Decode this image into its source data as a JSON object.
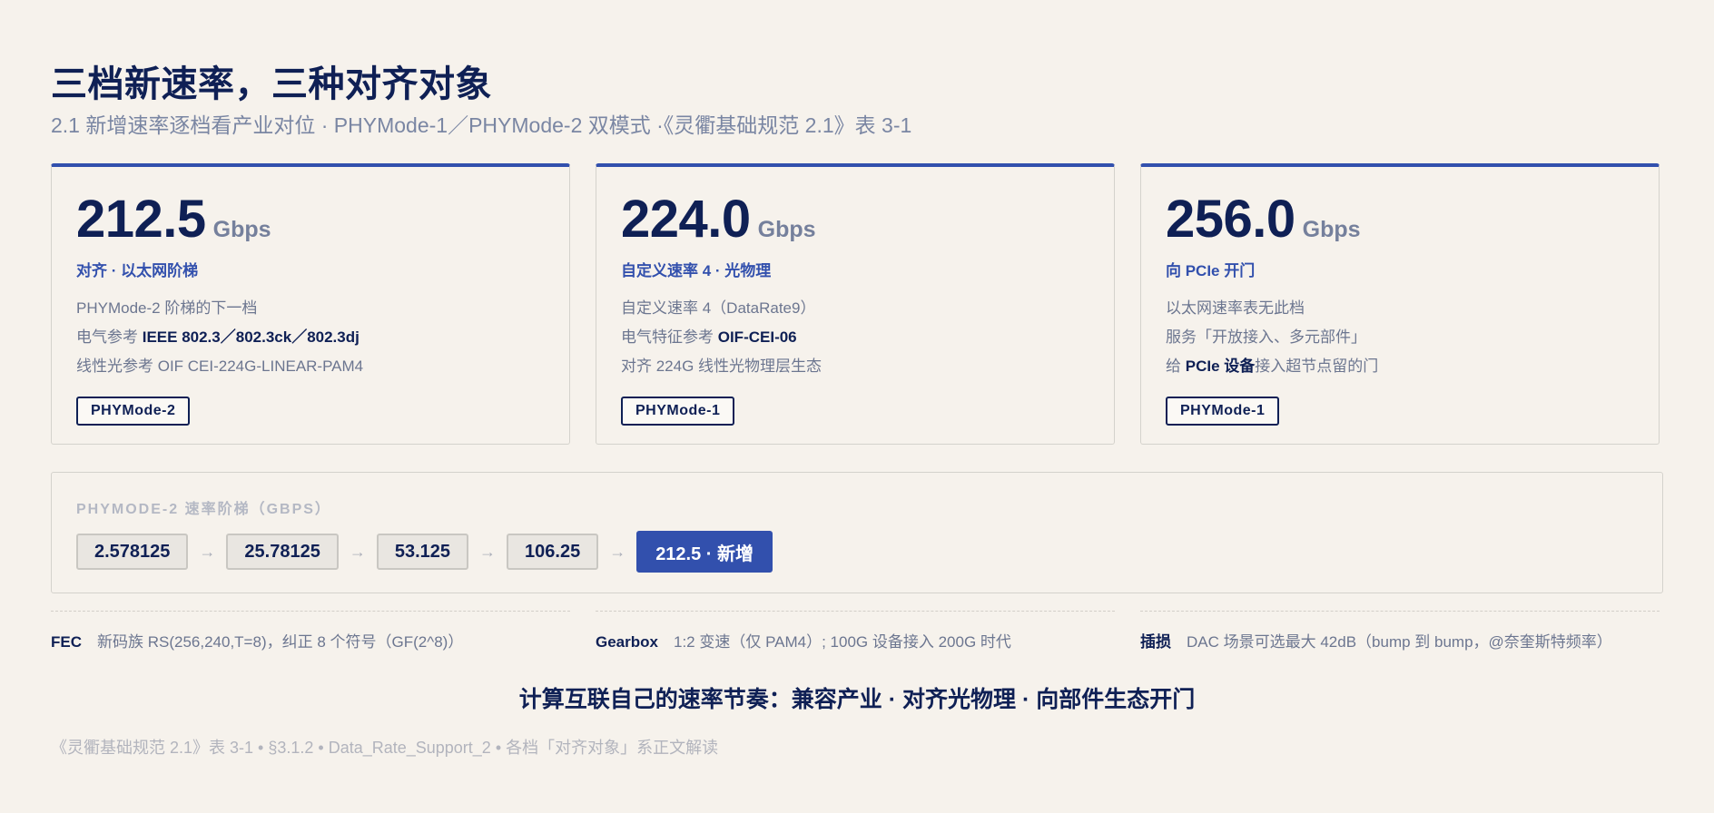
{
  "header": {
    "title": "三档新速率，三种对齐对象",
    "subtitle": "2.1 新增速率逐档看产业对位 · PHYMode-1／PHYMode-2 双模式 ·《灵衢基础规范 2.1》表 3-1"
  },
  "cards": [
    {
      "value": "212.5",
      "unit": "Gbps",
      "tag": "对齐 · 以太网阶梯",
      "line1": "PHYMode-2 阶梯的下一档",
      "line2_pre": "电气参考 ",
      "line2_bold": "IEEE 802.3／802.3ck／802.3dj",
      "line2_post": "",
      "line3": "线性光参考 OIF CEI-224G-LINEAR-PAM4",
      "badge": "PHYMode-2"
    },
    {
      "value": "224.0",
      "unit": "Gbps",
      "tag": "自定义速率 4 · 光物理",
      "line1": "自定义速率 4（DataRate9）",
      "line2_pre": "电气特征参考 ",
      "line2_bold": "OIF-CEI-06",
      "line2_post": "",
      "line3": "对齐 224G 线性光物理层生态",
      "badge": "PHYMode-1"
    },
    {
      "value": "256.0",
      "unit": "Gbps",
      "tag": "向 PCIe 开门",
      "line1": "以太网速率表无此档",
      "line2_pre": "服务「开放接入、多元部件」",
      "line2_bold": "",
      "line2_post": "",
      "line3_pre": "给 ",
      "line3_bold": "PCIe 设备",
      "line3_post": "接入超节点留的门",
      "badge": "PHYMode-1"
    }
  ],
  "ladder": {
    "title": "PHYMODE-2 速率阶梯（GBPS）",
    "steps": [
      "2.578125",
      "25.78125",
      "53.125",
      "106.25"
    ],
    "new_step": "212.5 · 新增",
    "arrow": "→"
  },
  "notes": [
    {
      "key": "FEC",
      "text": "新码族 RS(256,240,T=8)，纠正 8 个符号（GF(2^8)）"
    },
    {
      "key": "Gearbox",
      "text": "1:2 变速（仅 PAM4）; 100G 设备接入 200G 时代"
    },
    {
      "key": "插损",
      "text": "DAC 场景可选最大 42dB（bump 到 bump，@奈奎斯特频率）"
    }
  ],
  "tagline": "计算互联自己的速率节奏：兼容产业 · 对齐光物理 · 向部件生态开门",
  "footer": "《灵衢基础规范 2.1》表 3-1 • §3.1.2 • Data_Rate_Support_2 • 各档「对齐对象」系正文解读",
  "colors": {
    "accent": "#3250ad",
    "ink": "#0f2055",
    "muted": "#6c7690",
    "background": "#f6f2ec"
  }
}
